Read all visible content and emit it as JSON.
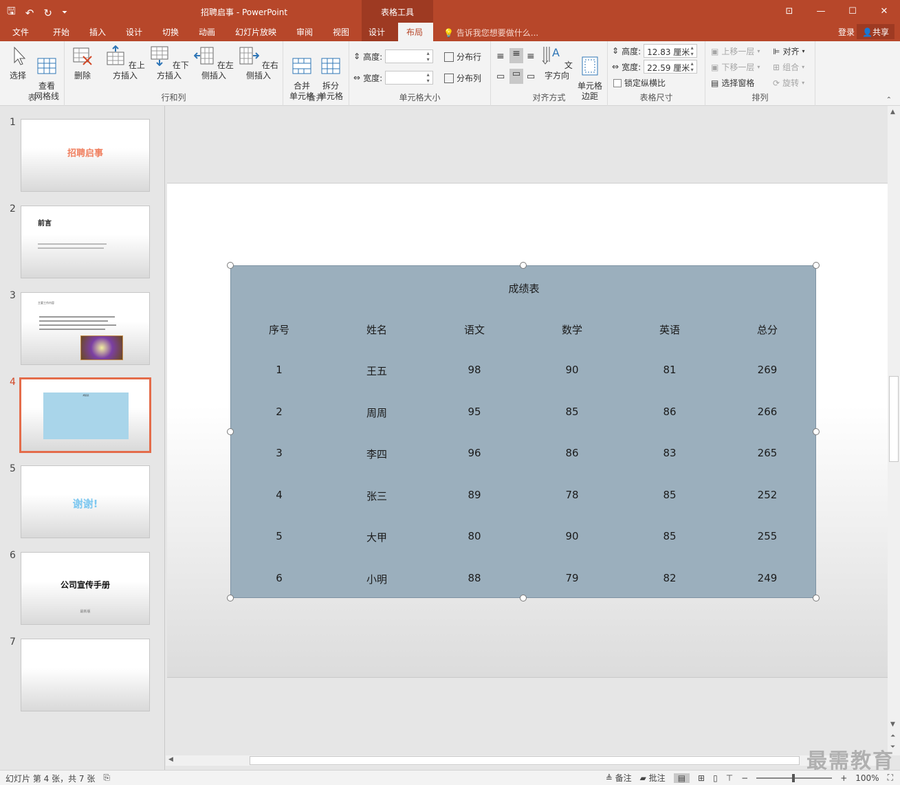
{
  "titlebar": {
    "title": "招聘启事 - PowerPoint",
    "context_tab": "表格工具",
    "qat": {
      "save": "🖫",
      "undo": "↶",
      "redo": "↻",
      "customize": "⏷"
    },
    "window_buttons": {
      "ribbon_options": "⊡",
      "minimize": "—",
      "maximize": "☐",
      "close": "✕"
    }
  },
  "tabs": {
    "items": [
      "文件",
      "开始",
      "插入",
      "设计",
      "切换",
      "动画",
      "幻灯片放映",
      "审阅",
      "视图"
    ],
    "design_ctx": "设计",
    "layout_ctx": "布局",
    "tell_me": "告诉我您想要做什么...",
    "login": "登录",
    "share": "共享"
  },
  "ribbon": {
    "table_group": {
      "label": "表",
      "select": "选择",
      "gridlines": "查看\n网格线"
    },
    "rows_cols_group": {
      "label": "行和列",
      "delete": "删除",
      "insert_above": "在上方插入",
      "insert_below": "在下方插入",
      "insert_left": "在左侧插入",
      "insert_right": "在右侧插入"
    },
    "merge_group": {
      "label": "合并",
      "merge": "合并\n单元格",
      "split": "拆分\n单元格"
    },
    "cell_size_group": {
      "label": "单元格大小",
      "height_label": "高度:",
      "width_label": "宽度:",
      "height_value": "",
      "width_value": "",
      "distribute_rows": "分布行",
      "distribute_cols": "分布列"
    },
    "alignment_group": {
      "label": "对齐方式",
      "text_direction": "文字方向",
      "cell_margins": "单元格\n边距"
    },
    "table_size_group": {
      "label": "表格尺寸",
      "height_label": "高度:",
      "height_value": "12.83 厘米",
      "width_label": "宽度:",
      "width_value": "22.59 厘米",
      "lock_aspect": "锁定纵横比"
    },
    "arrange_group": {
      "label": "排列",
      "bring_forward": "上移一层",
      "send_backward": "下移一层",
      "selection_pane": "选择窗格",
      "align": "对齐",
      "group": "组合",
      "rotate": "旋转"
    }
  },
  "slides_pane": {
    "slides": [
      {
        "num": "1",
        "title": "招聘启事"
      },
      {
        "num": "2",
        "title": "前言"
      },
      {
        "num": "3",
        "title": "主要工作内容"
      },
      {
        "num": "4",
        "title": "成绩表"
      },
      {
        "num": "5",
        "title": "谢谢!"
      },
      {
        "num": "6",
        "title": "公司宣传手册",
        "subtitle": "最新版"
      },
      {
        "num": "7",
        "title": ""
      }
    ]
  },
  "table": {
    "title": "成绩表",
    "headers": [
      "序号",
      "姓名",
      "语文",
      "数学",
      "英语",
      "总分"
    ],
    "rows": [
      [
        "1",
        "王五",
        "98",
        "90",
        "81",
        "269"
      ],
      [
        "2",
        "周周",
        "95",
        "85",
        "86",
        "266"
      ],
      [
        "3",
        "李四",
        "96",
        "86",
        "83",
        "265"
      ],
      [
        "4",
        "张三",
        "89",
        "78",
        "85",
        "252"
      ],
      [
        "5",
        "大甲",
        "80",
        "90",
        "85",
        "255"
      ],
      [
        "6",
        "小明",
        "88",
        "79",
        "82",
        "249"
      ]
    ]
  },
  "statusbar": {
    "slide_info": "幻灯片 第 4 张，共 7 张",
    "notes": "备注",
    "comments": "批注",
    "zoom": "100%"
  },
  "watermark": "最需教育",
  "colors": {
    "accent": "#b7472a",
    "table_fill": "#9bafbd",
    "active_thumb": "#e46c4a"
  }
}
